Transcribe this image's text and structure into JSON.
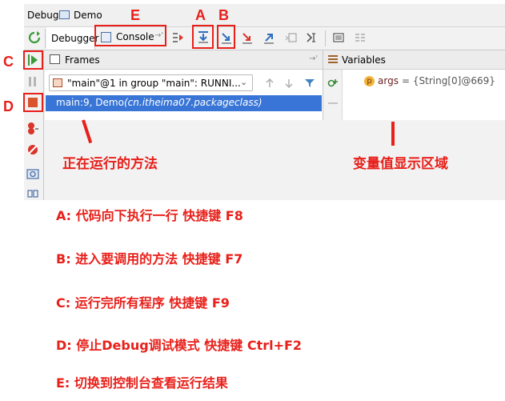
{
  "window": {
    "tab_label": "Debug",
    "config_name": "Demo"
  },
  "toolbar": {
    "debugger_tab": "Debugger",
    "console_tab": "Console"
  },
  "frames": {
    "title": "Frames",
    "thread_selector": "\"main\"@1 in group \"main\": RUNNI...",
    "frame_method": "main:9, Demo",
    "frame_class": "(cn.itheima07.packageclass)"
  },
  "variables": {
    "title": "Variables",
    "items": [
      {
        "name": "args",
        "value": "= {String[0]@669}",
        "badge": "p"
      }
    ]
  },
  "markers": {
    "A": "A",
    "B": "B",
    "C": "C",
    "D": "D",
    "E": "E"
  },
  "captions": {
    "running_method": "正在运行的方法",
    "variable_area": "变量值显示区域"
  },
  "notes": [
    "A: 代码向下执行一行 快捷键 F8",
    "B: 进入要调用的方法 快捷键 F7",
    "C: 运行完所有程序 快捷键 F9",
    "D: 停止Debug调试模式 快捷键 Ctrl+F2",
    "E: 切换到控制台查看运行结果"
  ],
  "colors": {
    "annotation_red": "#e8201a",
    "selection_blue": "#3875d6",
    "toolbar_bg": "#f2f2f2"
  }
}
